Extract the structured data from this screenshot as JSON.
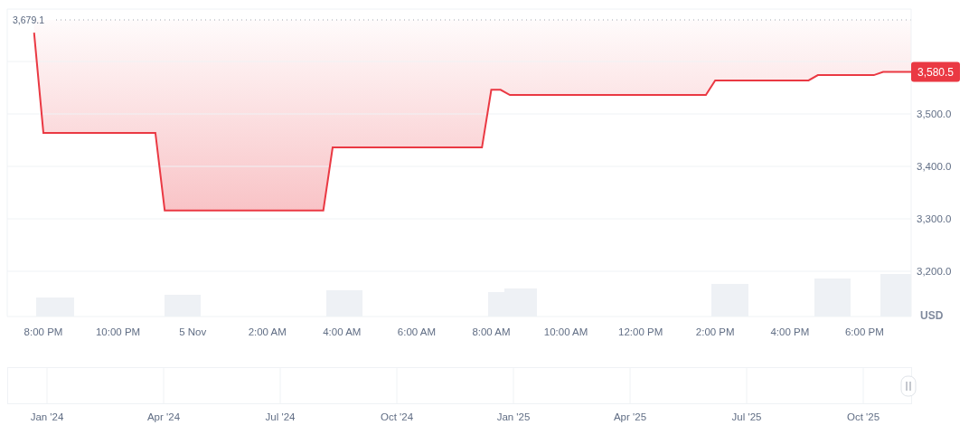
{
  "price_chart": {
    "currency": "USD",
    "current_price": "3,580.5",
    "high_label": "3,679.1",
    "chart_data": {
      "type": "line",
      "grid": true,
      "ylim": [
        3113.8,
        3700
      ],
      "yticks": [
        {
          "value": 3200,
          "label": "3,200.0"
        },
        {
          "value": 3300,
          "label": "3,300.0"
        },
        {
          "value": 3400,
          "label": "3,400.0"
        },
        {
          "value": 3500,
          "label": "3,500.0"
        }
      ],
      "categories": [
        null,
        "8:00 PM",
        null,
        null,
        null,
        null,
        null,
        null,
        null,
        "10:00 PM",
        null,
        null,
        null,
        null,
        null,
        null,
        null,
        "5 Nov",
        null,
        null,
        null,
        null,
        null,
        null,
        null,
        "2:00 AM",
        null,
        null,
        null,
        null,
        null,
        null,
        null,
        "4:00 AM",
        null,
        null,
        null,
        null,
        null,
        null,
        null,
        "6:00 AM",
        null,
        null,
        null,
        null,
        null,
        null,
        null,
        "8:00 AM",
        null,
        null,
        null,
        null,
        null,
        null,
        null,
        "10:00 AM",
        null,
        null,
        null,
        null,
        null,
        null,
        null,
        "12:00 PM",
        null,
        null,
        null,
        null,
        null,
        null,
        null,
        "2:00 PM",
        null,
        null,
        null,
        null,
        null,
        null,
        null,
        "4:00 PM",
        null,
        null,
        null,
        null,
        null,
        null,
        null,
        "6:00 PM",
        null,
        null,
        null,
        null,
        null
      ],
      "series": [
        {
          "color": "#ea3943",
          "values": [
            3655,
            3464,
            3464,
            3464,
            3464,
            3464,
            3464,
            3464,
            3464,
            3464,
            3464,
            3464,
            3464,
            3464,
            3316,
            3316,
            3316,
            3316,
            3316,
            3316,
            3316,
            3316,
            3316,
            3316,
            3316,
            3316,
            3316,
            3316,
            3316,
            3316,
            3316,
            3316,
            3436,
            3436,
            3436,
            3436,
            3436,
            3436,
            3436,
            3436,
            3436,
            3436,
            3436,
            3436,
            3436,
            3436,
            3436,
            3436,
            3436,
            3546,
            3546,
            3536,
            3536,
            3536,
            3536,
            3536,
            3536,
            3536,
            3536,
            3536,
            3536,
            3536,
            3536,
            3536,
            3536,
            3536,
            3536,
            3536,
            3536,
            3536,
            3536,
            3536,
            3536,
            3564,
            3564,
            3564,
            3564,
            3564,
            3564,
            3564,
            3564,
            3564,
            3564,
            3564,
            3574,
            3574,
            3574,
            3574,
            3574,
            3574,
            3574,
            3580,
            3580,
            3580,
            3580
          ]
        }
      ]
    }
  },
  "navigator": {
    "labels": [
      "Jan '24",
      "Apr '24",
      "Jul '24",
      "Oct '24",
      "Jan '25",
      "Apr '25",
      "Jul '25",
      "Oct '25"
    ]
  }
}
